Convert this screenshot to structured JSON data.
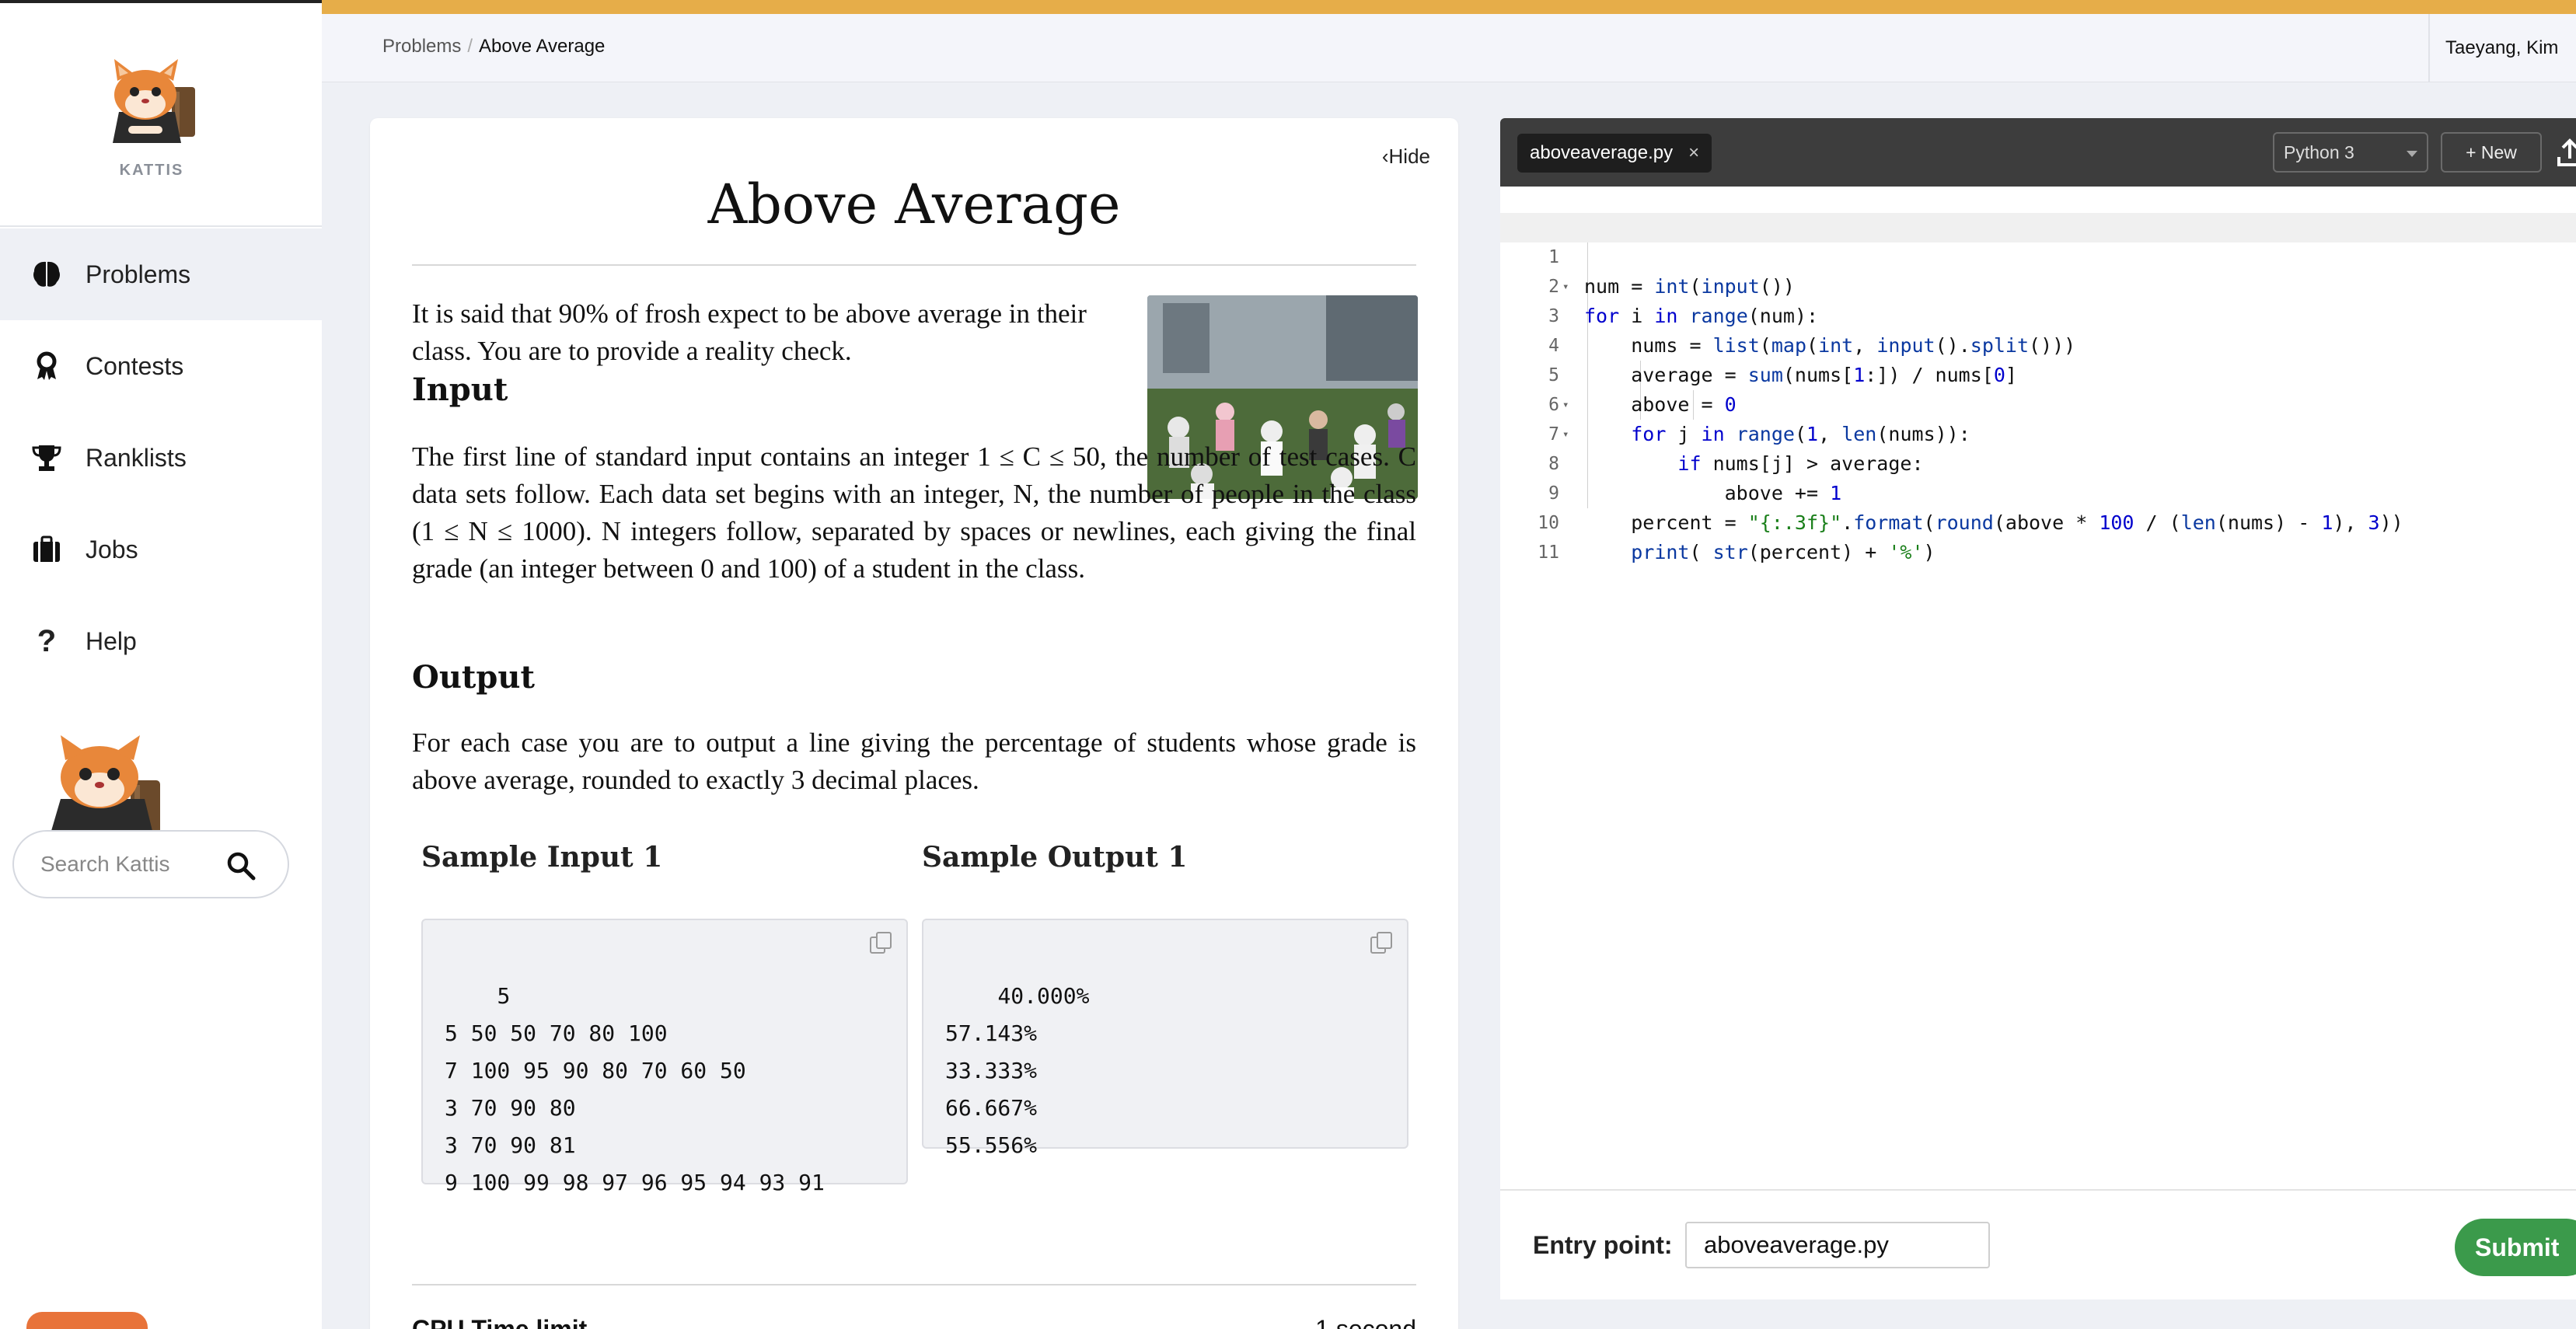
{
  "app": {
    "name": "KATTIS"
  },
  "sidebar": {
    "items": [
      {
        "label": "Problems",
        "icon": "brain-icon",
        "active": true
      },
      {
        "label": "Contests",
        "icon": "ribbon-icon",
        "active": false
      },
      {
        "label": "Ranklists",
        "icon": "trophy-icon",
        "active": false
      },
      {
        "label": "Jobs",
        "icon": "briefcase-icon",
        "active": false
      },
      {
        "label": "Help",
        "icon": "question-icon",
        "active": false
      }
    ],
    "search_placeholder": "Search Kattis"
  },
  "header": {
    "breadcrumb": [
      "Problems",
      "Above Average"
    ],
    "user": "Taeyang, Kim",
    "accent_color": "#e6ad49"
  },
  "problem": {
    "hide_label": "Hide",
    "title": "Above Average",
    "intro": "It is said that 90% of frosh expect to be above average in their class. You are to provide a reality check.",
    "input_heading": "Input",
    "input_text": "The first line of standard input contains an integer 1 ≤ C ≤ 50, the number of test cases. C data sets follow. Each data set begins with an integer, N, the number of people in the class (1 ≤ N ≤ 1000). N integers follow, separated by spaces or newlines, each giving the final grade (an integer between 0 and 100) of a student in the class.",
    "output_heading": "Output",
    "output_text": "For each case you are to output a line giving the percentage of students whose grade is above average, rounded to exactly 3 decimal places.",
    "sample_input_heading": "Sample Input 1",
    "sample_output_heading": "Sample Output 1",
    "sample_input": "5\n5 50 50 70 80 100\n7 100 95 90 80 70 60 50\n3 70 90 80\n3 70 90 81\n9 100 99 98 97 96 95 94 93 91",
    "sample_output": "40.000%\n57.143%\n33.333%\n66.667%\n55.556%",
    "cpu_label": "CPU Time limit",
    "cpu_value": "1 second"
  },
  "editor": {
    "file_tab": "aboveaverage.py",
    "close_glyph": "×",
    "language": "Python 3",
    "new_label": "+ New",
    "code_lines": [
      "num = int(input())",
      "for i in range(num):",
      "    nums = list(map(int, input().split()))",
      "    average = sum(nums[1:]) / nums[0]",
      "    above = 0",
      "    for j in range(1, len(nums)):",
      "        if nums[j] > average:",
      "            above += 1",
      "    percent = \"{:.3f}\".format(round(above * 100 / (len(nums) - 1), 3))",
      "    print( str(percent) + '%')",
      ""
    ],
    "entry_label": "Entry point:",
    "entry_value": "aboveaverage.py",
    "submit_label": "Submit",
    "submit_color": "#3b9a4b"
  }
}
